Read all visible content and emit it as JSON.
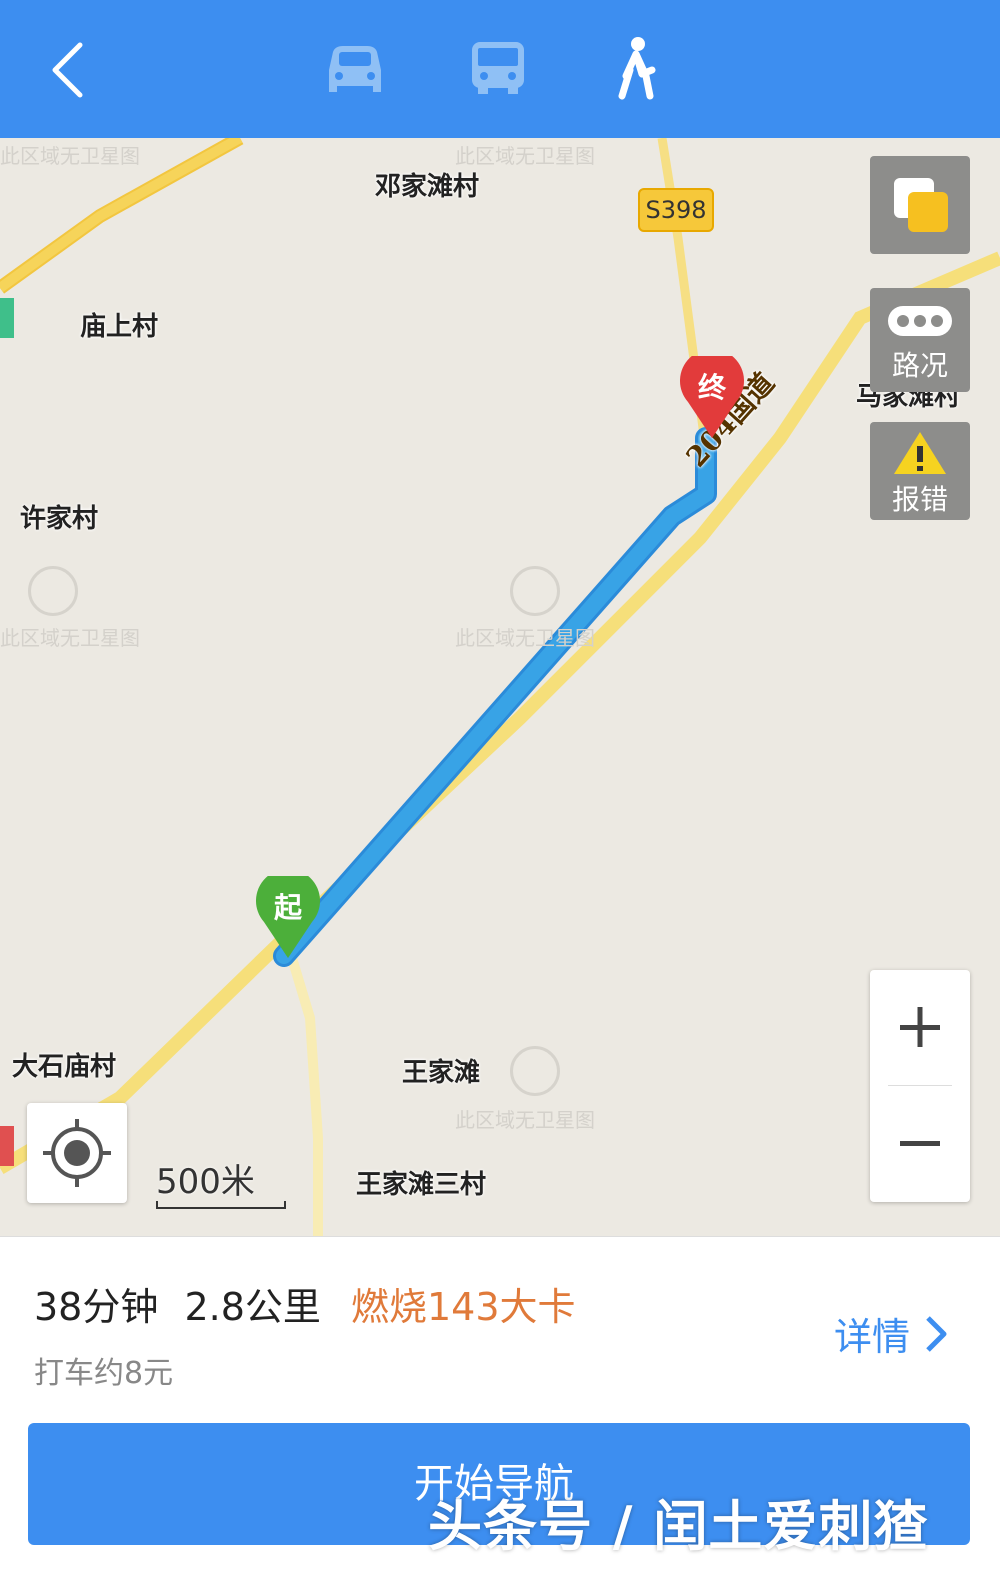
{
  "map": {
    "places": [
      {
        "id": "dengjiatan",
        "label": "邓家滩村"
      },
      {
        "id": "miaoshang",
        "label": "庙上村"
      },
      {
        "id": "majiatan",
        "label": "马家滩村"
      },
      {
        "id": "xujia",
        "label": "许家村"
      },
      {
        "id": "dashimiao",
        "label": "大石庙村"
      },
      {
        "id": "wangjiatan",
        "label": "王家滩"
      },
      {
        "id": "wangjiatan3",
        "label": "王家滩三村"
      }
    ],
    "watermark": "此区域无卫星图",
    "road_badge": "S398",
    "road_name": "204国道",
    "start_label": "起",
    "end_label": "终",
    "controls": {
      "traffic_label": "路况",
      "report_label": "报错"
    },
    "scale_label": "500米"
  },
  "route": {
    "time": "38分钟",
    "distance": "2.8公里",
    "calories": "燃烧143大卡",
    "taxi": "打车约8元",
    "detail_label": "详情"
  },
  "nav": {
    "start_label": "开始导航"
  },
  "overlay_text": "头条号 / 闰土爱刺猹",
  "colors": {
    "accent": "#3d8ef0",
    "route": "#38a3e6",
    "road": "#f6dd6e",
    "calories": "#e07a3a"
  }
}
